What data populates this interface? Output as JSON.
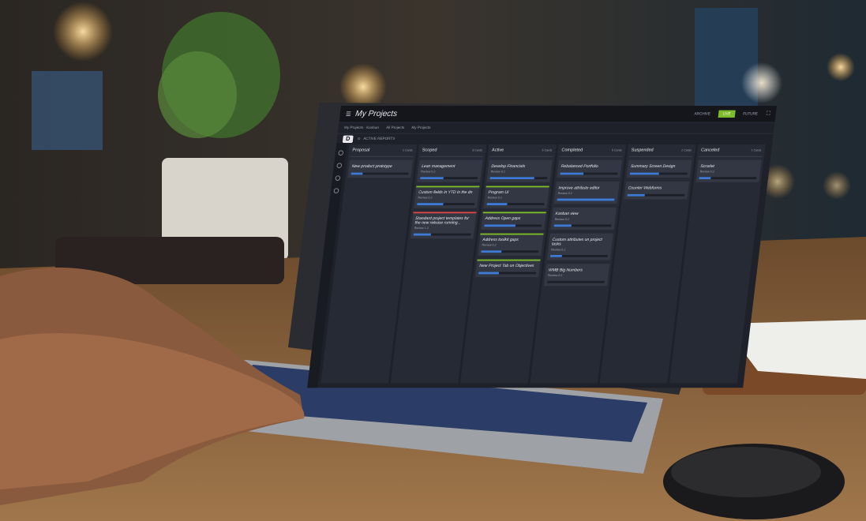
{
  "app": {
    "title": "My Projects"
  },
  "topbar": {
    "buttons": [
      "ARCHIVE",
      "LIVE",
      "FUTURE"
    ]
  },
  "breadcrumb": [
    "My Projects · Kanban",
    "All Projects",
    "My Projects"
  ],
  "toolbar": {
    "filter": "ACTIVE REPORTS"
  },
  "colors": {
    "accent": "#7dbb2a",
    "progress": "#3d7bd4",
    "danger": "#d94444"
  },
  "columns": [
    {
      "name": "Proposal",
      "count": "1 Cards",
      "cards": [
        {
          "title": "New product prototype",
          "date": "",
          "review": "",
          "progress": 0.2,
          "accent": ""
        }
      ]
    },
    {
      "name": "Scoped",
      "count": "3 Cards",
      "cards": [
        {
          "title": "Lean management",
          "date": "",
          "review": "Review 0.2",
          "progress": 0.4,
          "accent": ""
        },
        {
          "title": "Custom fields in YTD in the dn",
          "date": "",
          "review": "Review 0.2",
          "progress": 0.45,
          "accent": "g"
        },
        {
          "title": "Standard project templates for the new release running...",
          "date": "",
          "review": "Review 1.2",
          "progress": 0.3,
          "accent": "r"
        }
      ]
    },
    {
      "name": "Active",
      "count": "5 Cards",
      "cards": [
        {
          "title": "Develop Financials",
          "date": "",
          "review": "Review 0.2",
          "progress": 0.77,
          "accent": ""
        },
        {
          "title": "Program UI",
          "date": "",
          "review": "Review 0.2",
          "progress": 0.35,
          "accent": "g"
        },
        {
          "title": "Address Open gaps",
          "date": "",
          "review": "",
          "progress": 0.55,
          "accent": "g"
        },
        {
          "title": "Address toolkit gaps",
          "date": "",
          "review": "Review 0.2",
          "progress": 0.35,
          "accent": "g"
        },
        {
          "title": "New Project Tab on Objectives",
          "date": "",
          "review": "",
          "progress": 0.35,
          "accent": "g"
        }
      ]
    },
    {
      "name": "Completed",
      "count": "5 Cards",
      "cards": [
        {
          "title": "Rebalanced Portfolio",
          "date": "",
          "review": "",
          "progress": 0.4,
          "accent": ""
        },
        {
          "title": "Improve attribute editor",
          "date": "",
          "review": "Review 0.2",
          "progress": 1.0,
          "accent": ""
        },
        {
          "title": "Kanban view",
          "date": "",
          "review": "Review 0.2",
          "progress": 0.3,
          "accent": ""
        },
        {
          "title": "Custom attributes on project tasks",
          "date": "",
          "review": "Review 0.2",
          "progress": 0.2,
          "accent": ""
        },
        {
          "title": "WMB Big Numbers",
          "date": "",
          "review": "Review 0.2",
          "progress": 0.0,
          "accent": ""
        }
      ]
    },
    {
      "name": "Suspended",
      "count": "2 Cards",
      "cards": [
        {
          "title": "Summary Screen Design",
          "date": "",
          "review": "",
          "progress": 0.5,
          "accent": ""
        },
        {
          "title": "Counter Webforms",
          "date": "",
          "review": "",
          "progress": 0.3,
          "accent": ""
        }
      ]
    },
    {
      "name": "Canceled",
      "count": "1 Cards",
      "cards": [
        {
          "title": "Scrarlet",
          "date": "",
          "review": "Review 0.2",
          "progress": 0.2,
          "accent": ""
        }
      ]
    }
  ]
}
